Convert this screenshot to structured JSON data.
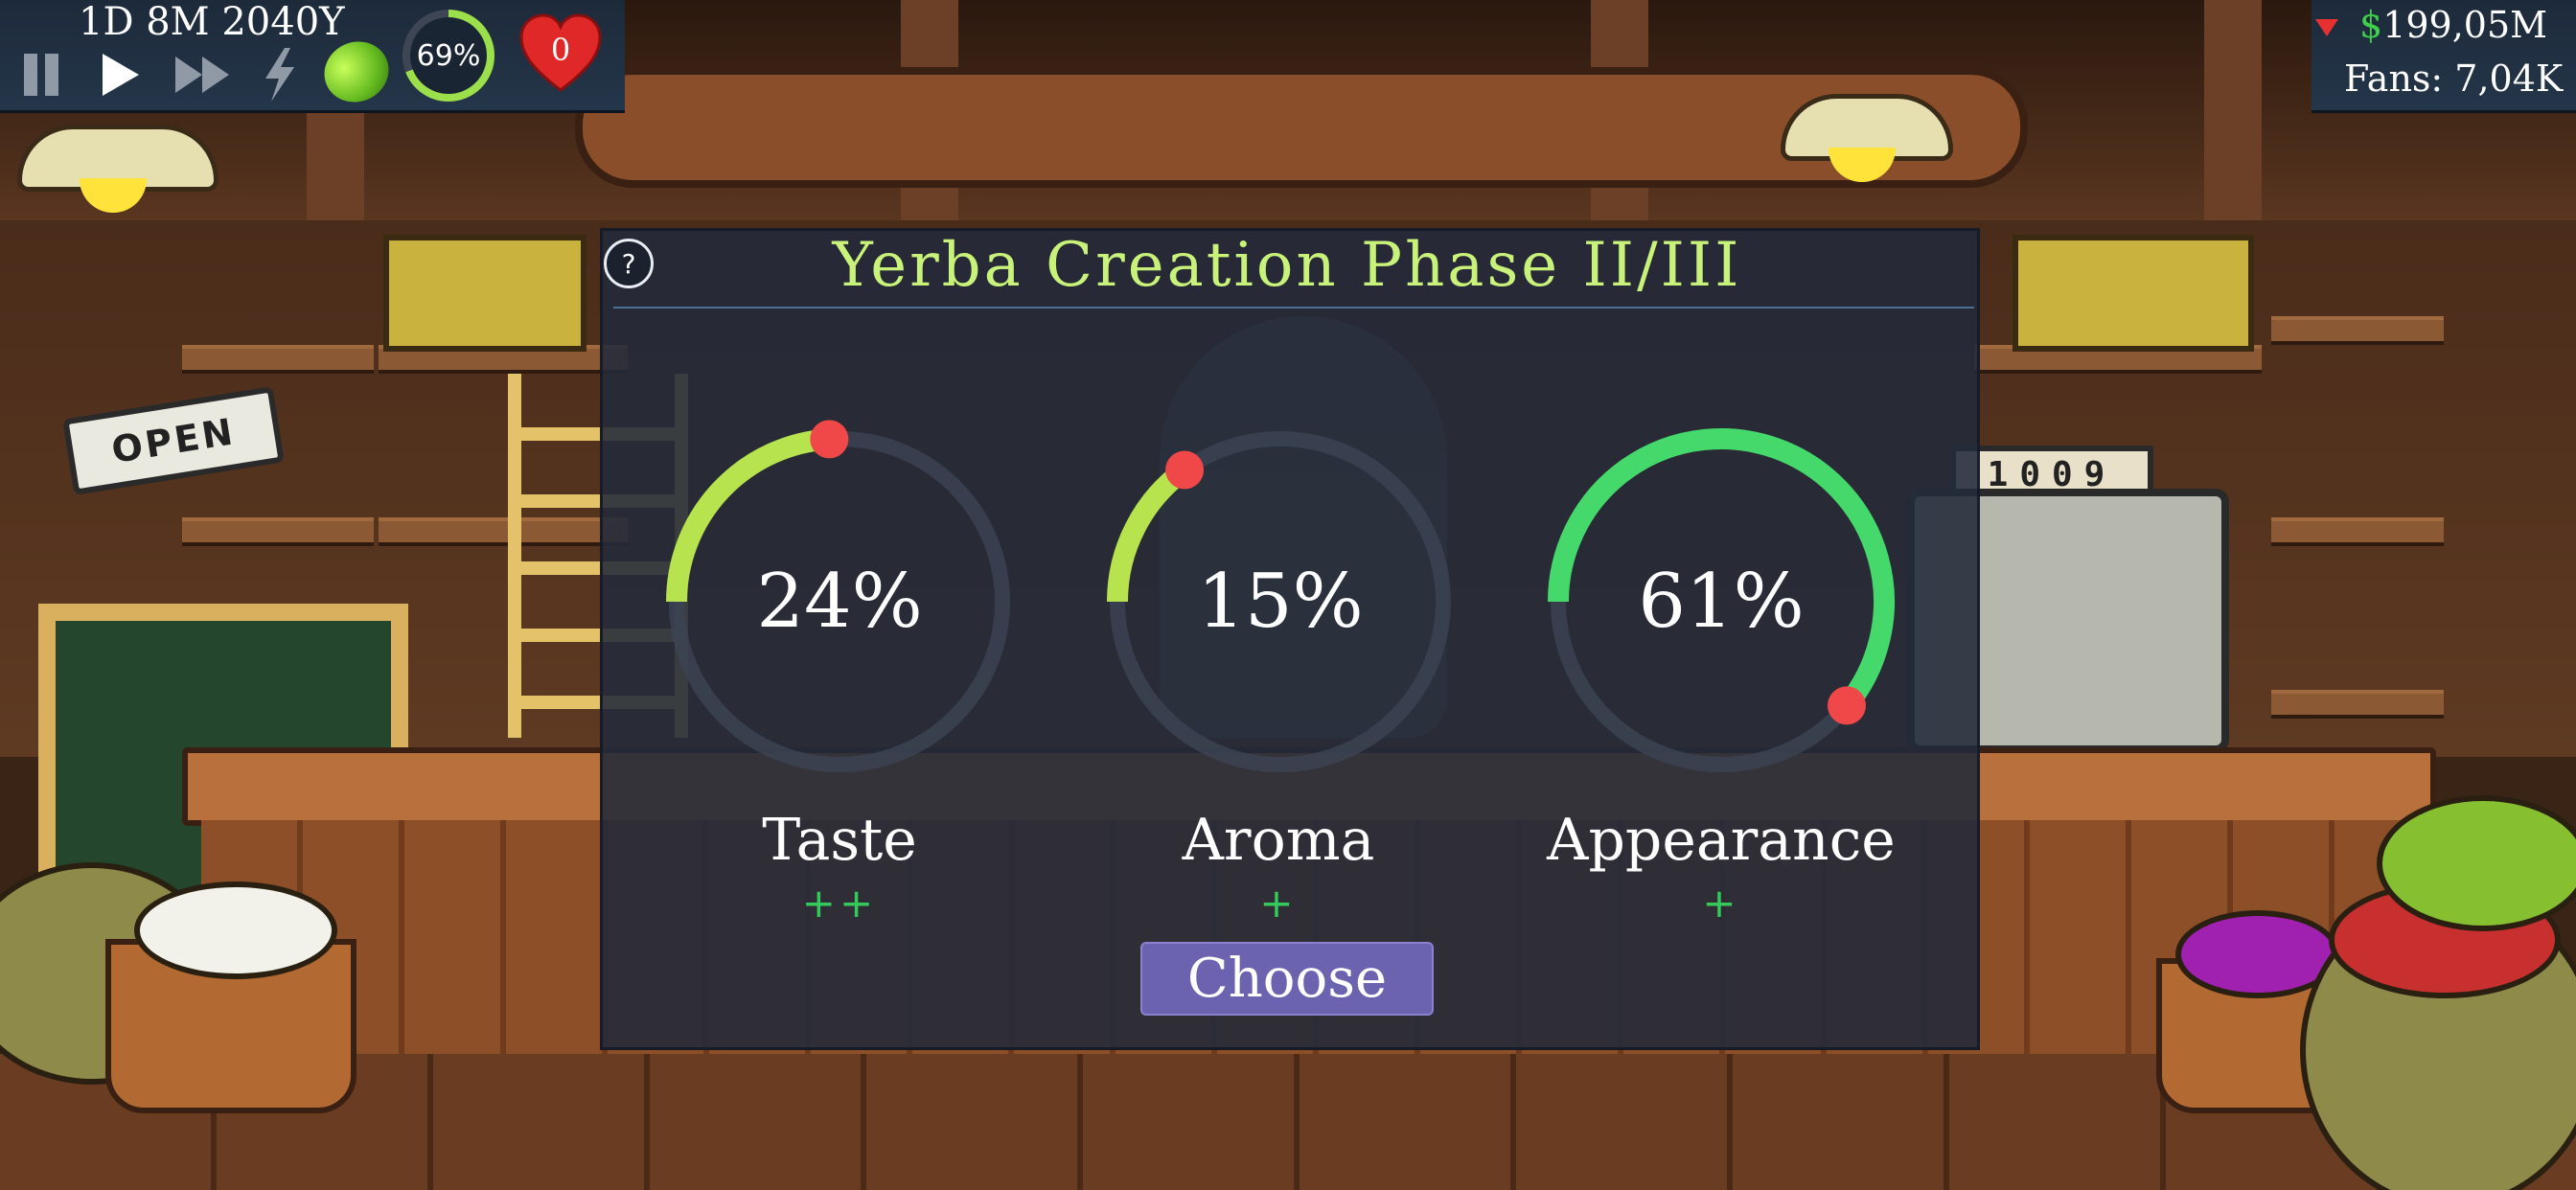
{
  "hud": {
    "date": "1D 8M 2040Y",
    "controls": {
      "pause_icon": "pause-icon",
      "play_icon": "play-icon",
      "fast_forward_icon": "fast-forward-icon",
      "boost_icon": "lightning-icon"
    },
    "lime_icon": "lime-icon",
    "progress": {
      "label": "69%",
      "value": 0.69,
      "color": "#9be04a"
    },
    "hearts": {
      "label": "0",
      "icon": "heart-icon",
      "color": "#e02828"
    },
    "money": {
      "currency": "$",
      "amount": "199,05M",
      "trend": "down",
      "trend_color": "#e83030"
    },
    "fans": "Fans: 7,04K"
  },
  "dialog": {
    "title": "Yerba Creation Phase II/III",
    "help_label": "?",
    "stats": [
      {
        "label": "Taste",
        "value_label": "24%",
        "value": 24,
        "rating": "++"
      },
      {
        "label": "Aroma",
        "value_label": "15%",
        "value": 15,
        "rating": "+"
      },
      {
        "label": "Appearance",
        "value_label": "61%",
        "value": 61,
        "rating": "+"
      }
    ],
    "choose_label": "Choose"
  },
  "scene": {
    "open_sign": "OPEN",
    "register_counter": "1009"
  },
  "colors": {
    "title": "#c9f27a",
    "gauge_track": "#3e4656",
    "gauge_low": "#b7e34e",
    "gauge_high": "#44d96a",
    "gauge_knob": "#f04848",
    "rating": "#34c95a",
    "button": "#6c63b0"
  }
}
